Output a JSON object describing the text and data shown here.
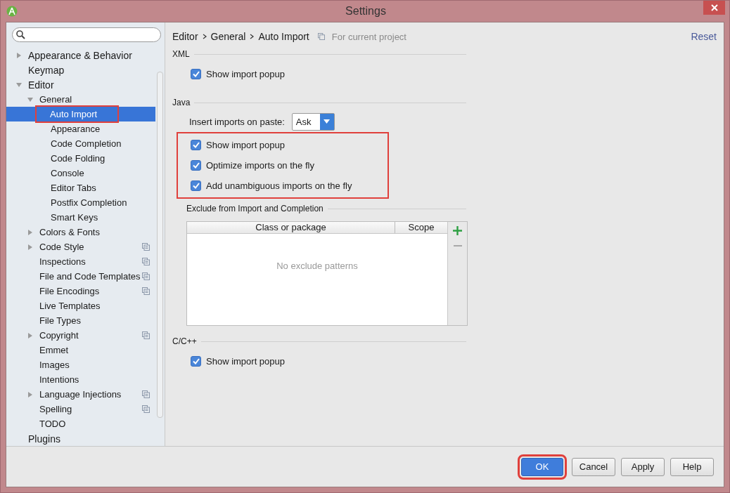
{
  "window": {
    "title": "Settings"
  },
  "tree": [
    {
      "label": "Appearance & Behavior",
      "expanded": false,
      "selected": false,
      "highlighted": false,
      "project_scoped": false
    },
    {
      "label": "Keymap",
      "selected": false,
      "highlighted": false,
      "project_scoped": false
    },
    {
      "label": "Editor",
      "expanded": true,
      "selected": false,
      "highlighted": false,
      "project_scoped": false,
      "children": [
        {
          "label": "General",
          "expanded": true,
          "selected": false,
          "highlighted": false,
          "project_scoped": false,
          "children": [
            {
              "label": "Auto Import",
              "selected": true,
              "highlighted": true,
              "project_scoped": false
            },
            {
              "label": "Appearance",
              "selected": false,
              "highlighted": false,
              "project_scoped": false
            },
            {
              "label": "Code Completion",
              "selected": false,
              "highlighted": false,
              "project_scoped": false
            },
            {
              "label": "Code Folding",
              "selected": false,
              "highlighted": false,
              "project_scoped": false
            },
            {
              "label": "Console",
              "selected": false,
              "highlighted": false,
              "project_scoped": false
            },
            {
              "label": "Editor Tabs",
              "selected": false,
              "highlighted": false,
              "project_scoped": false
            },
            {
              "label": "Postfix Completion",
              "selected": false,
              "highlighted": false,
              "project_scoped": false
            },
            {
              "label": "Smart Keys",
              "selected": false,
              "highlighted": false,
              "project_scoped": false
            }
          ]
        },
        {
          "label": "Colors & Fonts",
          "expanded": false,
          "selected": false,
          "highlighted": false,
          "project_scoped": false
        },
        {
          "label": "Code Style",
          "expanded": false,
          "selected": false,
          "highlighted": false,
          "project_scoped": true
        },
        {
          "label": "Inspections",
          "selected": false,
          "highlighted": false,
          "project_scoped": true
        },
        {
          "label": "File and Code Templates",
          "selected": false,
          "highlighted": false,
          "project_scoped": true
        },
        {
          "label": "File Encodings",
          "selected": false,
          "highlighted": false,
          "project_scoped": true
        },
        {
          "label": "Live Templates",
          "selected": false,
          "highlighted": false,
          "project_scoped": false
        },
        {
          "label": "File Types",
          "selected": false,
          "highlighted": false,
          "project_scoped": false
        },
        {
          "label": "Copyright",
          "expanded": false,
          "selected": false,
          "highlighted": false,
          "project_scoped": true
        },
        {
          "label": "Emmet",
          "selected": false,
          "highlighted": false,
          "project_scoped": false
        },
        {
          "label": "Images",
          "selected": false,
          "highlighted": false,
          "project_scoped": false
        },
        {
          "label": "Intentions",
          "selected": false,
          "highlighted": false,
          "project_scoped": false
        },
        {
          "label": "Language Injections",
          "expanded": false,
          "selected": false,
          "highlighted": false,
          "project_scoped": true
        },
        {
          "label": "Spelling",
          "selected": false,
          "highlighted": false,
          "project_scoped": true
        },
        {
          "label": "TODO",
          "selected": false,
          "highlighted": false,
          "project_scoped": false
        }
      ]
    },
    {
      "label": "Plugins",
      "selected": false,
      "highlighted": false,
      "project_scoped": false
    }
  ],
  "breadcrumb": [
    "Editor",
    "General",
    "Auto Import"
  ],
  "scope_note": "For current project",
  "reset": "Reset",
  "sections": [
    {
      "kind": "checks",
      "title": "XML",
      "highlighted": false,
      "checkboxes": [
        {
          "label": "Show import popup",
          "checked": true
        }
      ]
    },
    {
      "kind": "java",
      "title": "Java",
      "dropdown": {
        "label": "Insert imports on paste:",
        "value": "Ask"
      },
      "highlighted": true,
      "checkboxes": [
        {
          "label": "Show import popup",
          "checked": true
        },
        {
          "label": "Optimize imports on the fly",
          "checked": true
        },
        {
          "label": "Add unambiguous imports on the fly",
          "checked": true
        }
      ],
      "exclude": {
        "title": "Exclude from Import and Completion",
        "columns": [
          "Class or package",
          "Scope"
        ],
        "empty_text": "No exclude patterns"
      }
    },
    {
      "kind": "checks",
      "title": "C/C++",
      "highlighted": false,
      "checkboxes": [
        {
          "label": "Show import popup",
          "checked": true
        }
      ]
    }
  ],
  "buttons": [
    {
      "label": "OK",
      "default": true,
      "highlighted": true
    },
    {
      "label": "Cancel",
      "default": false,
      "highlighted": false
    },
    {
      "label": "Apply",
      "default": false,
      "highlighted": false
    },
    {
      "label": "Help",
      "default": false,
      "highlighted": false
    }
  ]
}
